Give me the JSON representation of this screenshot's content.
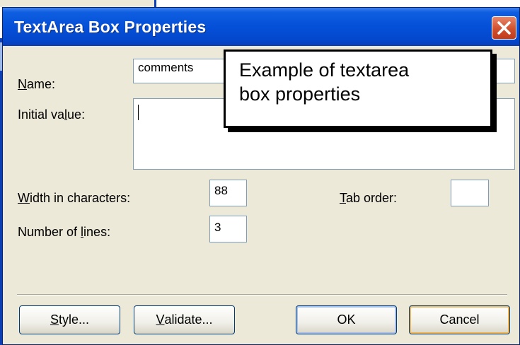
{
  "dialog": {
    "title": "TextArea Box Properties",
    "close_icon": "close-icon"
  },
  "form": {
    "name_label_mnemonic": "N",
    "name_label_rest": "ame:",
    "name_value": "comments",
    "initial_label_pre": "Initial va",
    "initial_label_mnemonic": "l",
    "initial_label_post": "ue:",
    "initial_value": "",
    "width_label_mnemonic": "W",
    "width_label_rest": "idth in characters:",
    "width_value": "88",
    "tab_label_mnemonic": "T",
    "tab_label_rest": "ab order:",
    "tab_value": "",
    "lines_label_pre": "Number of ",
    "lines_label_mnemonic": "l",
    "lines_label_post": "ines:",
    "lines_value": "3"
  },
  "buttons": {
    "style_mnemonic": "S",
    "style_rest": "tyle...",
    "validate_mnemonic": "V",
    "validate_rest": "alidate...",
    "ok": "OK",
    "cancel": "Cancel"
  },
  "callout": {
    "line1": "Example of textarea",
    "line2": "box properties"
  },
  "colors": {
    "titlebar": "#0450d8",
    "dialog_bg": "#ece9d8",
    "field_border": "#7f9db9",
    "close_button": "#d0502d"
  }
}
